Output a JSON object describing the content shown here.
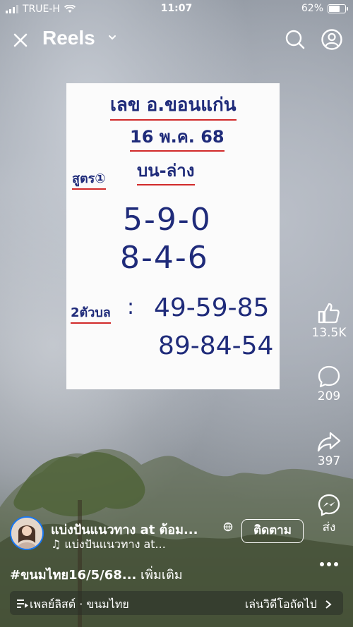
{
  "status_bar": {
    "carrier": "TRUE-H",
    "time": "11:07",
    "battery": "62%",
    "battery_level": 0.62
  },
  "header": {
    "title": "Reels"
  },
  "post_image": {
    "title": "เลข อ.ขอนแก่น",
    "date": "16 พ.ค. 68",
    "formula_label": "สูตร①",
    "position_label": "บน-ล่าง",
    "row1": "5-9-0",
    "row2": "8-4-6",
    "two_digit_label": "2ตัวบล",
    "colon": ":",
    "pairs_row1": "49-59-85",
    "pairs_row2": "89-84-54"
  },
  "actions": {
    "likes": "13.5K",
    "comments": "209",
    "shares": "397",
    "send_label": "ส่ง"
  },
  "author": {
    "name": "แบ่งปันแนวทาง at ต้อม...",
    "audio": "♫ แบ่งปันแนวทาง at...",
    "follow_label": "ติดตาม"
  },
  "caption": {
    "hashtag": "#ขนมไทย16/5/68...",
    "more": " เพิ่มเติม"
  },
  "bottom_bar": {
    "playlist": "เพลย์ลิสต์ · ขนมไทย",
    "next": "เล่นวิดีโอถัดไป"
  },
  "colors": {
    "ink": "#1f2b7a",
    "underline": "#d12a2a",
    "follow_ring": "#1877f2"
  }
}
